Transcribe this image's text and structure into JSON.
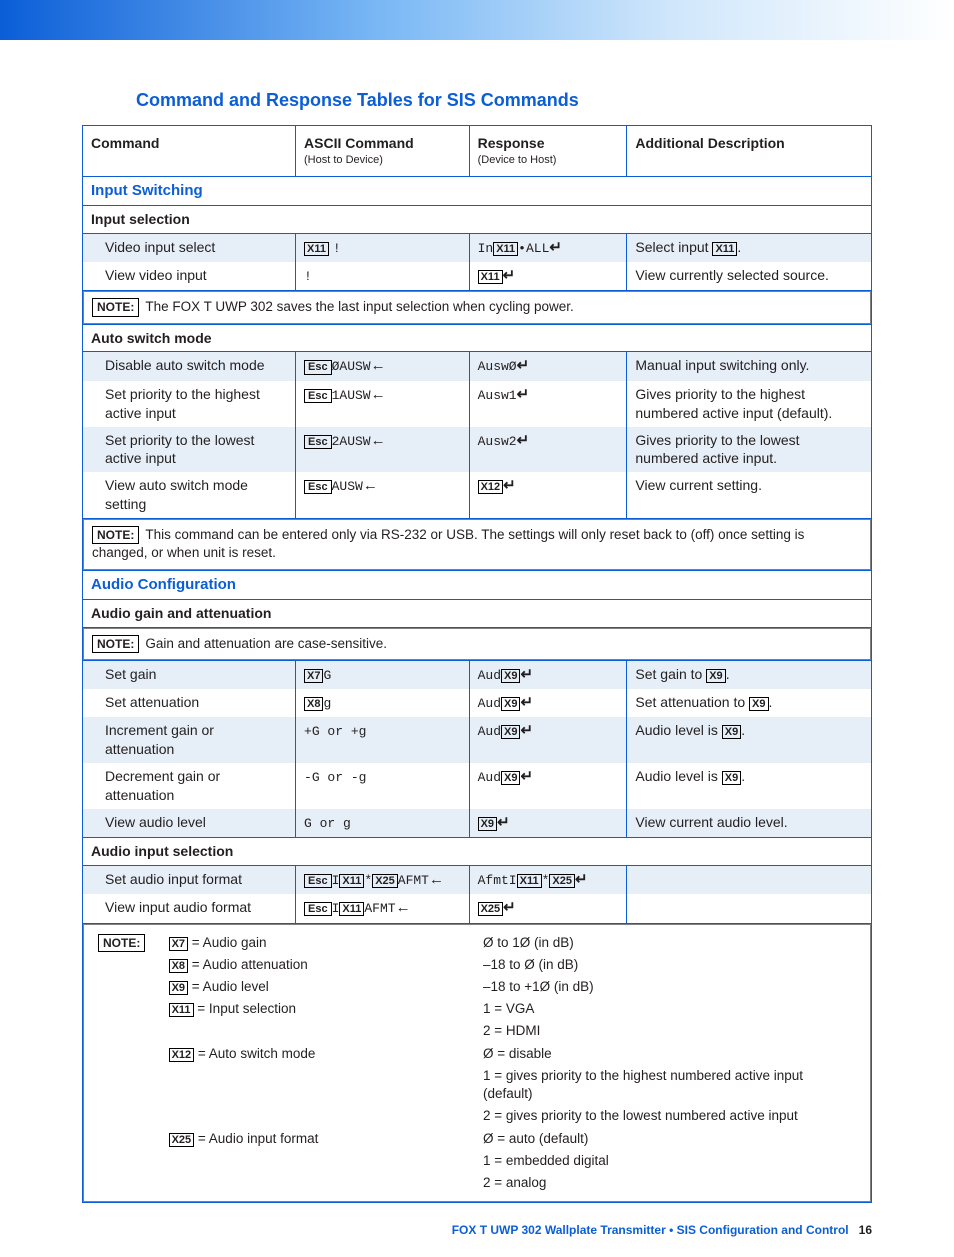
{
  "title": "Command and Response Tables for SIS Commands",
  "columns": {
    "c1": "Command",
    "c2": "ASCII Command",
    "c2sub": "(Host to Device)",
    "c3": "Response",
    "c3sub": "(Device to Host)",
    "c4": "Additional Description"
  },
  "sections": {
    "input_switching": "Input Switching",
    "input_selection": "Input selection",
    "auto_switch_mode": "Auto switch mode",
    "audio_config": "Audio Configuration",
    "audio_gain_att": "Audio gain and attenuation",
    "audio_input_sel": "Audio input selection"
  },
  "rows": {
    "vis": {
      "cmd": "Video input select",
      "desc_pre": "Select input ",
      "desc_post": "."
    },
    "vvi": {
      "cmd": "View video input",
      "ascii": "!",
      "desc": "View currently selected source."
    },
    "dasm": {
      "cmd": "Disable auto switch mode",
      "ascii_mid": "ØAUSW",
      "resp": "AuswØ",
      "desc": "Manual input switching only."
    },
    "sph": {
      "cmd": "Set priority to the highest active input",
      "ascii_mid": "1AUSW",
      "resp": "Ausw1",
      "desc": "Gives priority to the highest numbered active input (default)."
    },
    "spl": {
      "cmd": "Set priority to the lowest active input",
      "ascii_mid": "2AUSW",
      "resp": "Ausw2",
      "desc": "Gives priority to the lowest numbered active input."
    },
    "vasm": {
      "cmd": "View auto switch mode setting",
      "ascii_mid": "AUSW",
      "desc": "View current setting."
    },
    "gain": {
      "cmd": "Set gain",
      "ascii_post": "G",
      "resp_pre": "Aud",
      "desc_pre": "Set gain to ",
      "desc_post": "."
    },
    "att": {
      "cmd": "Set attenuation",
      "ascii_post": "g",
      "resp_pre": "Aud",
      "desc_pre": "Set attenuation to ",
      "desc_post": "."
    },
    "inc": {
      "cmd": "Increment gain or attenuation",
      "ascii": "+G or +g",
      "resp_pre": "Aud",
      "desc_pre": "Audio level is ",
      "desc_post": "."
    },
    "dec": {
      "cmd": "Decrement gain or attenuation",
      "ascii": "-G or -g",
      "resp_pre": "Aud",
      "desc_pre": "Audio level is ",
      "desc_post": "."
    },
    "val": {
      "cmd": "View audio level",
      "ascii": "G or g",
      "desc": "View current audio level."
    },
    "saif": {
      "cmd": "Set audio input format",
      "ascii_post": "AFMT",
      "resp_pre": "AfmtI"
    },
    "viaf": {
      "cmd": "View input audio format",
      "ascii_post": "AFMT"
    }
  },
  "notes": {
    "note_label": "NOTE:",
    "n1": "The FOX T UWP 302 saves the last input selection when cycling power.",
    "n2": "This command can be entered only via RS-232 or USB. The settings will only reset back to (off) once setting is changed, or when unit is reset.",
    "n3": "Gain and attenuation are case-sensitive."
  },
  "xcodes": {
    "x7": "X7",
    "x8": "X8",
    "x9": "X9",
    "x11": "X11",
    "x12": "X12",
    "x25": "X25",
    "esc": "Esc"
  },
  "legend": {
    "x7": " = Audio gain",
    "x7r": "Ø to 1Ø (in dB)",
    "x8": " = Audio attenuation",
    "x8r": "–18 to Ø (in dB)",
    "x9": " = Audio level",
    "x9r": "–18 to +1Ø (in dB)",
    "x11": " = Input selection",
    "x11r1": "1 = VGA",
    "x11r2": "2 = HDMI",
    "x12": " = Auto switch mode",
    "x12r1": "Ø = disable",
    "x12r2": "1 = gives priority to the highest numbered active input (default)",
    "x12r3": "2 = gives priority to the lowest numbered active input",
    "x25": " = Audio input format",
    "x25r1": "Ø = auto (default)",
    "x25r2": "1 = embedded digital",
    "x25r3": "2 = analog"
  },
  "resp_misc": {
    "in": "In",
    "all": "ALL",
    "bang": "!",
    "star": "*",
    "I": "I"
  },
  "footer": {
    "text": "FOX T UWP 302 Wallplate Transmitter • SIS Configuration and Control",
    "page": "16"
  }
}
